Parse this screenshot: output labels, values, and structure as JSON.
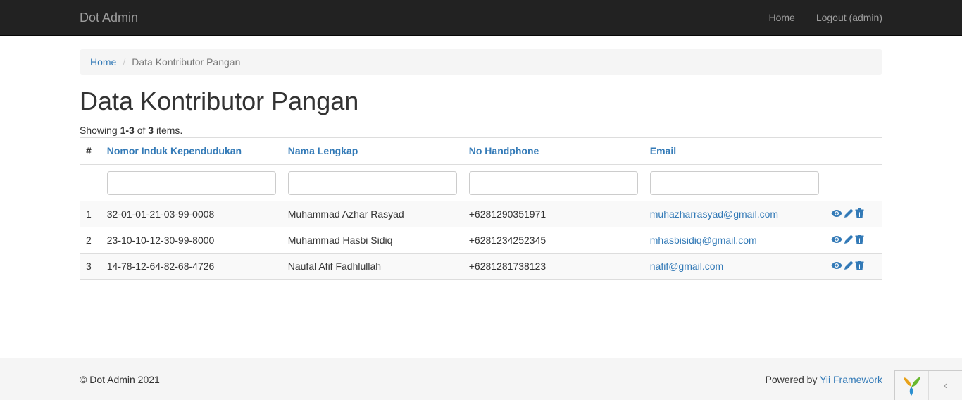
{
  "navbar": {
    "brand": "Dot Admin",
    "links": [
      "Home",
      "Logout (admin)"
    ]
  },
  "breadcrumb": {
    "home": "Home",
    "separator": "/",
    "current": "Data Kontributor Pangan"
  },
  "page": {
    "title": "Data Kontributor Pangan"
  },
  "summary": {
    "prefix": "Showing ",
    "range": "1-3",
    "middle": " of ",
    "total": "3",
    "suffix": " items."
  },
  "table": {
    "columns": [
      "#",
      "Nomor Induk Kependudukan",
      "Nama Lengkap",
      "No Handphone",
      "Email",
      ""
    ],
    "rows": [
      {
        "no": "1",
        "nik": "32-01-01-21-03-99-0008",
        "name": "Muhammad Azhar Rasyad",
        "phone": "+6281290351971",
        "email": "muhazharrasyad@gmail.com"
      },
      {
        "no": "2",
        "nik": "23-10-10-12-30-99-8000",
        "name": "Muhammad Hasbi Sidiq",
        "phone": "+6281234252345",
        "email": "mhasbisidiq@gmail.com"
      },
      {
        "no": "3",
        "nik": "14-78-12-64-82-68-4726",
        "name": "Naufal Afif Fadhlullah",
        "phone": "+6281281738123",
        "email": "nafif@gmail.com"
      }
    ],
    "action_icons": [
      "eye-icon",
      "pencil-icon",
      "trash-icon"
    ]
  },
  "footer": {
    "copyright": "© Dot Admin 2021",
    "powered_prefix": "Powered by ",
    "powered_link": "Yii Framework"
  },
  "debug_toolbar": {
    "toggle_glyph": "‹"
  },
  "colors": {
    "navbar_bg": "#222222",
    "link": "#337ab7",
    "footer_bg": "#f5f5f5"
  }
}
